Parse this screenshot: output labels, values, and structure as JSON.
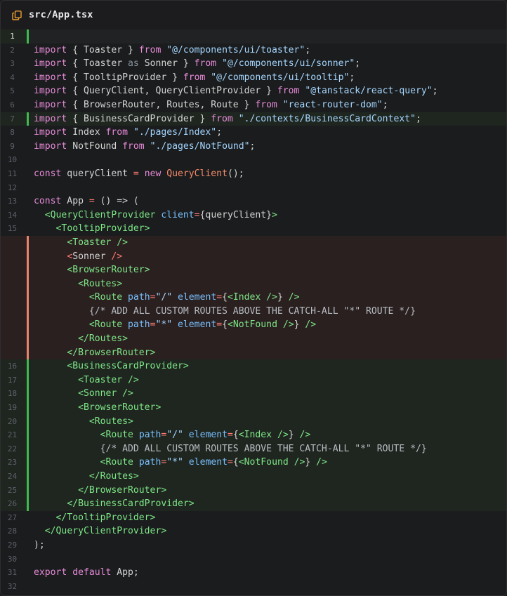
{
  "header": {
    "file_icon": "copy-file-icon",
    "path": "src/App.tsx"
  },
  "colors": {
    "added": "#3fb950",
    "removed": "#e8836e",
    "keyword": "#e78ad8",
    "string": "#a5d6ff",
    "tag": "#7ee787",
    "attr": "#79c0ff"
  },
  "lines": [
    {
      "n": "1",
      "state": "add",
      "current": true,
      "tokens": []
    },
    {
      "n": "2",
      "state": "",
      "tokens": [
        [
          "kw",
          "import"
        ],
        [
          "p",
          " { Toaster } "
        ],
        [
          "kw",
          "from"
        ],
        [
          "p",
          " "
        ],
        [
          "s",
          "\"@/components/ui/toaster\""
        ],
        [
          "p",
          ";"
        ]
      ]
    },
    {
      "n": "3",
      "state": "",
      "tokens": [
        [
          "kw",
          "import"
        ],
        [
          "p",
          " { Toaster "
        ],
        [
          "dim",
          "as"
        ],
        [
          "p",
          " Sonner } "
        ],
        [
          "kw",
          "from"
        ],
        [
          "p",
          " "
        ],
        [
          "s",
          "\"@/components/ui/sonner\""
        ],
        [
          "p",
          ";"
        ]
      ]
    },
    {
      "n": "4",
      "state": "",
      "tokens": [
        [
          "kw",
          "import"
        ],
        [
          "p",
          " { TooltipProvider } "
        ],
        [
          "kw",
          "from"
        ],
        [
          "p",
          " "
        ],
        [
          "s",
          "\"@/components/ui/tooltip\""
        ],
        [
          "p",
          ";"
        ]
      ]
    },
    {
      "n": "5",
      "state": "",
      "tokens": [
        [
          "kw",
          "import"
        ],
        [
          "p",
          " { QueryClient, QueryClientProvider } "
        ],
        [
          "kw",
          "from"
        ],
        [
          "p",
          " "
        ],
        [
          "s",
          "\"@tanstack/react-query\""
        ],
        [
          "p",
          ";"
        ]
      ]
    },
    {
      "n": "6",
      "state": "",
      "tokens": [
        [
          "kw",
          "import"
        ],
        [
          "p",
          " { BrowserRouter, Routes, Route } "
        ],
        [
          "kw",
          "from"
        ],
        [
          "p",
          " "
        ],
        [
          "s",
          "\"react-router-dom\""
        ],
        [
          "p",
          ";"
        ]
      ]
    },
    {
      "n": "7",
      "state": "add",
      "tokens": [
        [
          "kw",
          "import"
        ],
        [
          "p",
          " { BusinessCardProvider } "
        ],
        [
          "kw",
          "from"
        ],
        [
          "p",
          " "
        ],
        [
          "s",
          "\"./contexts/BusinessCardContext\""
        ],
        [
          "p",
          ";"
        ]
      ]
    },
    {
      "n": "8",
      "state": "",
      "tokens": [
        [
          "kw",
          "import"
        ],
        [
          "p",
          " Index "
        ],
        [
          "kw",
          "from"
        ],
        [
          "p",
          " "
        ],
        [
          "s",
          "\"./pages/Index\""
        ],
        [
          "p",
          ";"
        ]
      ]
    },
    {
      "n": "9",
      "state": "",
      "tokens": [
        [
          "kw",
          "import"
        ],
        [
          "p",
          " NotFound "
        ],
        [
          "kw",
          "from"
        ],
        [
          "p",
          " "
        ],
        [
          "s",
          "\"./pages/NotFound\""
        ],
        [
          "p",
          ";"
        ]
      ]
    },
    {
      "n": "10",
      "state": "",
      "tokens": []
    },
    {
      "n": "11",
      "state": "",
      "tokens": [
        [
          "kw",
          "const"
        ],
        [
          "p",
          " queryClient "
        ],
        [
          "op",
          "="
        ],
        [
          "p",
          " "
        ],
        [
          "kw",
          "new"
        ],
        [
          "p",
          " "
        ],
        [
          "fn",
          "QueryClient"
        ],
        [
          "p",
          "();"
        ]
      ]
    },
    {
      "n": "12",
      "state": "",
      "tokens": []
    },
    {
      "n": "13",
      "state": "",
      "tokens": [
        [
          "kw",
          "const"
        ],
        [
          "p",
          " App "
        ],
        [
          "op",
          "="
        ],
        [
          "p",
          " () => ("
        ]
      ]
    },
    {
      "n": "14",
      "state": "",
      "tokens": [
        [
          "p",
          "  "
        ],
        [
          "tg",
          "<QueryClientProvider"
        ],
        [
          "p",
          " "
        ],
        [
          "at",
          "client"
        ],
        [
          "op",
          "="
        ],
        [
          "p",
          "{queryClient}"
        ],
        [
          "tg",
          ">"
        ]
      ]
    },
    {
      "n": "15",
      "state": "",
      "tokens": [
        [
          "p",
          "    "
        ],
        [
          "tg",
          "<TooltipProvider>"
        ]
      ]
    },
    {
      "n": "",
      "state": "del",
      "tokens": [
        [
          "p",
          "      "
        ],
        [
          "tg",
          "<Toaster />"
        ]
      ]
    },
    {
      "n": "",
      "state": "del",
      "tokens": [
        [
          "p",
          "      "
        ],
        [
          "op",
          "<"
        ],
        [
          "p",
          "Sonner "
        ],
        [
          "op",
          "/>"
        ]
      ]
    },
    {
      "n": "",
      "state": "del",
      "tokens": [
        [
          "p",
          "      "
        ],
        [
          "tg",
          "<BrowserRouter>"
        ]
      ]
    },
    {
      "n": "",
      "state": "del",
      "tokens": [
        [
          "p",
          "        "
        ],
        [
          "tg",
          "<Routes>"
        ]
      ]
    },
    {
      "n": "",
      "state": "del",
      "tokens": [
        [
          "p",
          "          "
        ],
        [
          "tg",
          "<Route"
        ],
        [
          "p",
          " "
        ],
        [
          "at",
          "path"
        ],
        [
          "op",
          "="
        ],
        [
          "s",
          "\"/\""
        ],
        [
          "p",
          " "
        ],
        [
          "at",
          "element"
        ],
        [
          "op",
          "="
        ],
        [
          "p",
          "{"
        ],
        [
          "tg",
          "<Index />"
        ],
        [
          "p",
          "} "
        ],
        [
          "tg",
          "/>"
        ]
      ]
    },
    {
      "n": "",
      "state": "del",
      "tokens": [
        [
          "p",
          "          "
        ],
        [
          "cm",
          "{/* ADD ALL CUSTOM ROUTES ABOVE THE CATCH-ALL \"*\" ROUTE */}"
        ]
      ]
    },
    {
      "n": "",
      "state": "del",
      "tokens": [
        [
          "p",
          "          "
        ],
        [
          "tg",
          "<Route"
        ],
        [
          "p",
          " "
        ],
        [
          "at",
          "path"
        ],
        [
          "op",
          "="
        ],
        [
          "s",
          "\"*\""
        ],
        [
          "p",
          " "
        ],
        [
          "at",
          "element"
        ],
        [
          "op",
          "="
        ],
        [
          "p",
          "{"
        ],
        [
          "tg",
          "<NotFound />"
        ],
        [
          "p",
          "} "
        ],
        [
          "tg",
          "/>"
        ]
      ]
    },
    {
      "n": "",
      "state": "del",
      "tokens": [
        [
          "p",
          "        "
        ],
        [
          "tg",
          "</Routes>"
        ]
      ]
    },
    {
      "n": "",
      "state": "del",
      "tokens": [
        [
          "p",
          "      "
        ],
        [
          "tg",
          "</BrowserRouter>"
        ]
      ]
    },
    {
      "n": "16",
      "state": "add",
      "tokens": [
        [
          "p",
          "      "
        ],
        [
          "tg",
          "<BusinessCardProvider>"
        ]
      ]
    },
    {
      "n": "17",
      "state": "add",
      "tokens": [
        [
          "p",
          "        "
        ],
        [
          "tg",
          "<Toaster />"
        ]
      ]
    },
    {
      "n": "18",
      "state": "add",
      "tokens": [
        [
          "p",
          "        "
        ],
        [
          "tg",
          "<Sonner />"
        ]
      ]
    },
    {
      "n": "19",
      "state": "add",
      "tokens": [
        [
          "p",
          "        "
        ],
        [
          "tg",
          "<BrowserRouter>"
        ]
      ]
    },
    {
      "n": "20",
      "state": "add",
      "tokens": [
        [
          "p",
          "          "
        ],
        [
          "tg",
          "<Routes>"
        ]
      ]
    },
    {
      "n": "21",
      "state": "add",
      "tokens": [
        [
          "p",
          "            "
        ],
        [
          "tg",
          "<Route"
        ],
        [
          "p",
          " "
        ],
        [
          "at",
          "path"
        ],
        [
          "op",
          "="
        ],
        [
          "s",
          "\"/\""
        ],
        [
          "p",
          " "
        ],
        [
          "at",
          "element"
        ],
        [
          "op",
          "="
        ],
        [
          "p",
          "{"
        ],
        [
          "tg",
          "<Index />"
        ],
        [
          "p",
          "} "
        ],
        [
          "tg",
          "/>"
        ]
      ]
    },
    {
      "n": "22",
      "state": "add",
      "tokens": [
        [
          "p",
          "            "
        ],
        [
          "cm",
          "{/* ADD ALL CUSTOM ROUTES ABOVE THE CATCH-ALL \"*\" ROUTE */}"
        ]
      ]
    },
    {
      "n": "23",
      "state": "add",
      "tokens": [
        [
          "p",
          "            "
        ],
        [
          "tg",
          "<Route"
        ],
        [
          "p",
          " "
        ],
        [
          "at",
          "path"
        ],
        [
          "op",
          "="
        ],
        [
          "s",
          "\"*\""
        ],
        [
          "p",
          " "
        ],
        [
          "at",
          "element"
        ],
        [
          "op",
          "="
        ],
        [
          "p",
          "{"
        ],
        [
          "tg",
          "<NotFound />"
        ],
        [
          "p",
          "} "
        ],
        [
          "tg",
          "/>"
        ]
      ]
    },
    {
      "n": "24",
      "state": "add",
      "tokens": [
        [
          "p",
          "          "
        ],
        [
          "tg",
          "</Routes>"
        ]
      ]
    },
    {
      "n": "25",
      "state": "add",
      "tokens": [
        [
          "p",
          "        "
        ],
        [
          "tg",
          "</BrowserRouter>"
        ]
      ]
    },
    {
      "n": "26",
      "state": "add",
      "tokens": [
        [
          "p",
          "      "
        ],
        [
          "tg",
          "</BusinessCardProvider>"
        ]
      ]
    },
    {
      "n": "27",
      "state": "",
      "tokens": [
        [
          "p",
          "    "
        ],
        [
          "tg",
          "</TooltipProvider>"
        ]
      ]
    },
    {
      "n": "28",
      "state": "",
      "tokens": [
        [
          "p",
          "  "
        ],
        [
          "tg",
          "</QueryClientProvider>"
        ]
      ]
    },
    {
      "n": "29",
      "state": "",
      "tokens": [
        [
          "p",
          ");"
        ]
      ]
    },
    {
      "n": "30",
      "state": "",
      "tokens": []
    },
    {
      "n": "31",
      "state": "",
      "tokens": [
        [
          "kw",
          "export"
        ],
        [
          "p",
          " "
        ],
        [
          "kw",
          "default"
        ],
        [
          "p",
          " App;"
        ]
      ]
    },
    {
      "n": "32",
      "state": "",
      "tokens": []
    }
  ]
}
